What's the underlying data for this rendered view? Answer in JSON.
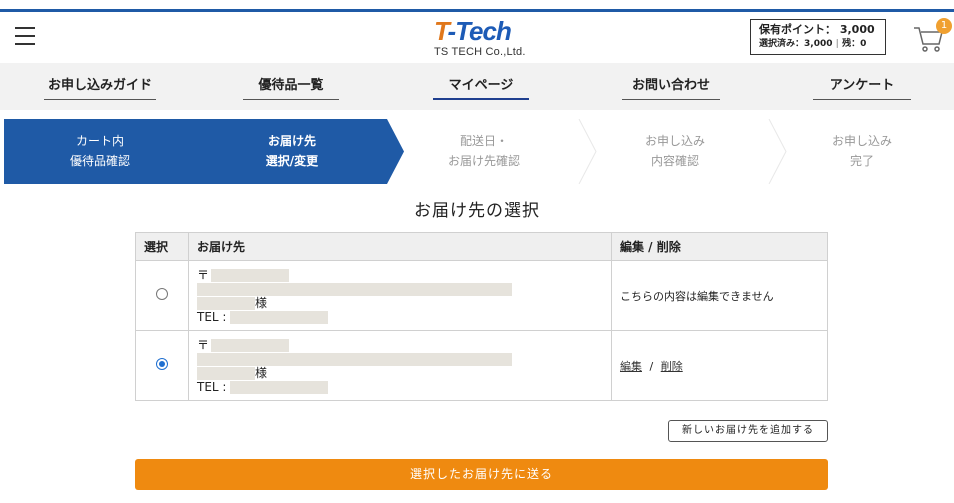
{
  "header": {
    "logo_mark_t": "T",
    "logo_mark_rest": "-Tech",
    "logo_sub": "TS TECH Co.,Ltd.",
    "points_label": "保有ポイント：",
    "points_value": "3,000",
    "selected_label": "選択済み：",
    "selected_value": "3,000",
    "remaining_label": "残：",
    "remaining_value": "0",
    "cart_count": "1"
  },
  "nav": {
    "items": [
      {
        "label": "お申し込みガイド"
      },
      {
        "label": "優待品一覧"
      },
      {
        "label": "マイページ"
      },
      {
        "label": "お問い合わせ"
      },
      {
        "label": "アンケート"
      }
    ]
  },
  "steps": [
    {
      "line1": "カート内",
      "line2": "優待品確認"
    },
    {
      "line1": "お届け先",
      "line2": "選択/変更"
    },
    {
      "line1": "配送日・",
      "line2": "お届け先確認"
    },
    {
      "line1": "お申し込み",
      "line2": "内容確認"
    },
    {
      "line1": "お申し込み",
      "line2": "完了"
    }
  ],
  "colors": {
    "primary": "#1f5aa6",
    "accent": "#ef8a10",
    "logo_orange": "#e0771b"
  },
  "page_title": "お届け先の選択",
  "table": {
    "headers": [
      "選択",
      "お届け先",
      "編集 / 削除"
    ],
    "rows": [
      {
        "selected": false,
        "postal_mark": "〒",
        "honorific": "様",
        "tel_label": "TEL :",
        "action_text": "こちらの内容は編集できません"
      },
      {
        "selected": true,
        "postal_mark": "〒",
        "honorific": "様",
        "tel_label": "TEL :",
        "edit_label": "編集",
        "separator": "/",
        "delete_label": "削除"
      }
    ]
  },
  "buttons": {
    "add_address": "新しいお届け先を追加する",
    "send": "選択したお届け先に送る"
  }
}
